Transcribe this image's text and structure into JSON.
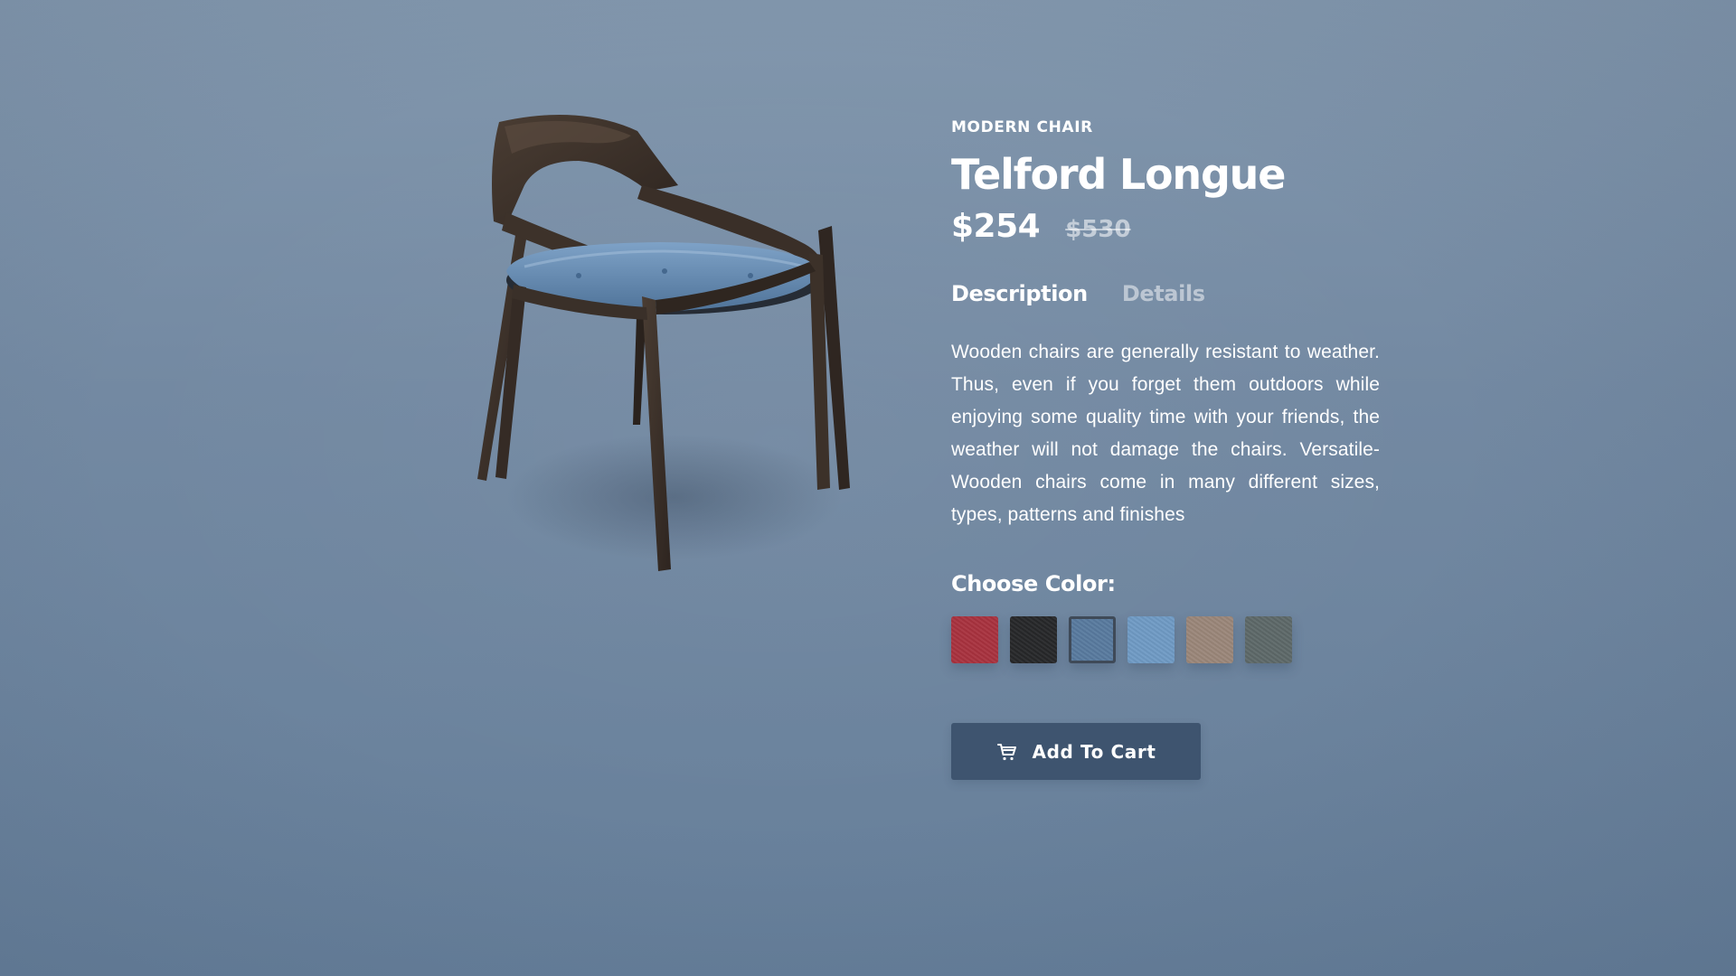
{
  "product": {
    "category": "MODERN CHAIR",
    "title": "Telford Longue",
    "price": "$254",
    "old_price": "$530",
    "image_icon": "chair-image"
  },
  "tabs": [
    {
      "label": "Description",
      "active": true
    },
    {
      "label": "Details",
      "active": false
    }
  ],
  "description": "Wooden chairs are generally resistant to weather. Thus, even if you forget them outdoors while enjoying some quality time with your friends, the weather will not damage the chairs. Versatile- Wooden chairs come in many different sizes, types, patterns and finishes",
  "colors": {
    "label": "Choose Color:",
    "options": [
      {
        "name": "red",
        "hex": "#a8323e",
        "selected": false
      },
      {
        "name": "black",
        "hex": "#262729",
        "selected": false
      },
      {
        "name": "denim-blue",
        "hex": "#587a9e",
        "selected": true
      },
      {
        "name": "light-blue",
        "hex": "#6f9ac4",
        "selected": false
      },
      {
        "name": "beige",
        "hex": "#9a8679",
        "selected": false
      },
      {
        "name": "grey-green",
        "hex": "#5d6868",
        "selected": false
      }
    ]
  },
  "cart_button": {
    "label": "Add To Cart",
    "icon": "cart-icon"
  },
  "theme": {
    "background": "#7389a2",
    "button": "#3e546f"
  }
}
